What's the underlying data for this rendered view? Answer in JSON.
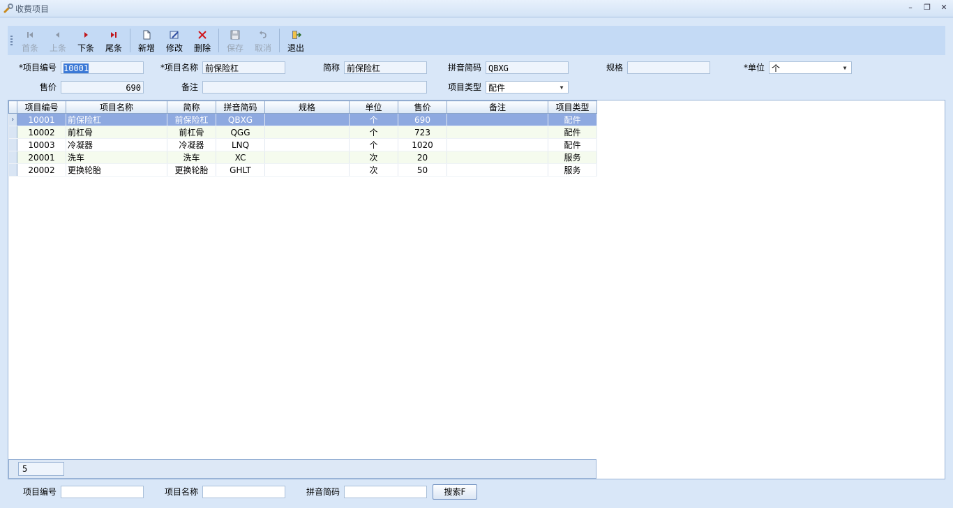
{
  "window": {
    "title": "收费项目"
  },
  "toolbar": {
    "first": "首条",
    "prev": "上条",
    "next": "下条",
    "last": "尾条",
    "add": "新增",
    "edit": "修改",
    "delete": "删除",
    "save": "保存",
    "cancel": "取消",
    "exit": "退出"
  },
  "form": {
    "code_label": "*项目编号",
    "code_value": "10001",
    "name_label": "*项目名称",
    "name_value": "前保险杠",
    "short_label": "简称",
    "short_value": "前保险杠",
    "pinyin_label": "拼音简码",
    "pinyin_value": "QBXG",
    "spec_label": "规格",
    "spec_value": "",
    "unit_label": "*单位",
    "unit_value": "个",
    "price_label": "售价",
    "price_value": "690",
    "remark_label": "备注",
    "remark_value": "",
    "type_label": "项目类型",
    "type_value": "配件"
  },
  "grid": {
    "columns": [
      "项目编号",
      "项目名称",
      "简称",
      "拼音简码",
      "规格",
      "单位",
      "售价",
      "备注",
      "项目类型"
    ],
    "rows": [
      [
        "10001",
        "前保险杠",
        "前保险杠",
        "QBXG",
        "",
        "个",
        "690",
        "",
        "配件"
      ],
      [
        "10002",
        "前杠骨",
        "前杠骨",
        "QGG",
        "",
        "个",
        "723",
        "",
        "配件"
      ],
      [
        "10003",
        "冷凝器",
        "冷凝器",
        "LNQ",
        "",
        "个",
        "1020",
        "",
        "配件"
      ],
      [
        "20001",
        "洗车",
        "洗车",
        "XC",
        "",
        "次",
        "20",
        "",
        "服务"
      ],
      [
        "20002",
        "更换轮胎",
        "更换轮胎",
        "GHLT",
        "",
        "次",
        "50",
        "",
        "服务"
      ]
    ],
    "row_count": "5",
    "selected_indicator": "›"
  },
  "search": {
    "code_label": "项目编号",
    "code_value": "",
    "name_label": "项目名称",
    "name_value": "",
    "pinyin_label": "拼音简码",
    "pinyin_value": "",
    "button": "搜索F"
  },
  "colors": {
    "toolbar_bg": "#c4daf5",
    "page_bg": "#d9e7f8",
    "selected_row": "#8ea9e0",
    "alt_row": "#f5fbee"
  }
}
